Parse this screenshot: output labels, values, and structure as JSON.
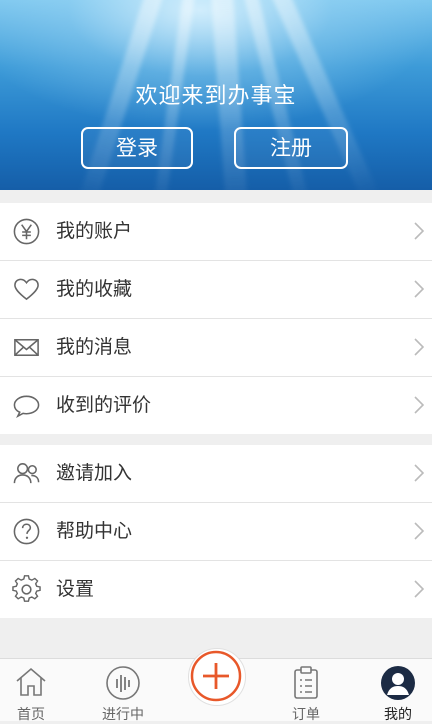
{
  "header": {
    "title": "欢迎来到办事宝",
    "login_label": "登录",
    "register_label": "注册"
  },
  "menu_primary": [
    {
      "label": "我的账户",
      "icon": "yen-circle-icon"
    },
    {
      "label": "我的收藏",
      "icon": "heart-icon"
    },
    {
      "label": "我的消息",
      "icon": "envelope-icon"
    },
    {
      "label": "收到的评价",
      "icon": "chat-bubble-icon"
    }
  ],
  "menu_secondary": [
    {
      "label": "邀请加入",
      "icon": "users-icon"
    },
    {
      "label": "帮助中心",
      "icon": "question-circle-icon"
    },
    {
      "label": "设置",
      "icon": "gear-icon"
    }
  ],
  "tabbar": [
    {
      "label": "首页",
      "icon": "home-icon"
    },
    {
      "label": "进行中",
      "icon": "progress-icon"
    },
    {
      "label": "",
      "icon": "plus-circle-icon"
    },
    {
      "label": "订单",
      "icon": "clipboard-icon"
    },
    {
      "label": "我的",
      "icon": "avatar-icon",
      "active": true
    }
  ],
  "colors": {
    "accent": "#e8582a",
    "header_blue": "#1f78c4",
    "icon_gray": "#666666",
    "active_tab": "#1c2b44"
  }
}
